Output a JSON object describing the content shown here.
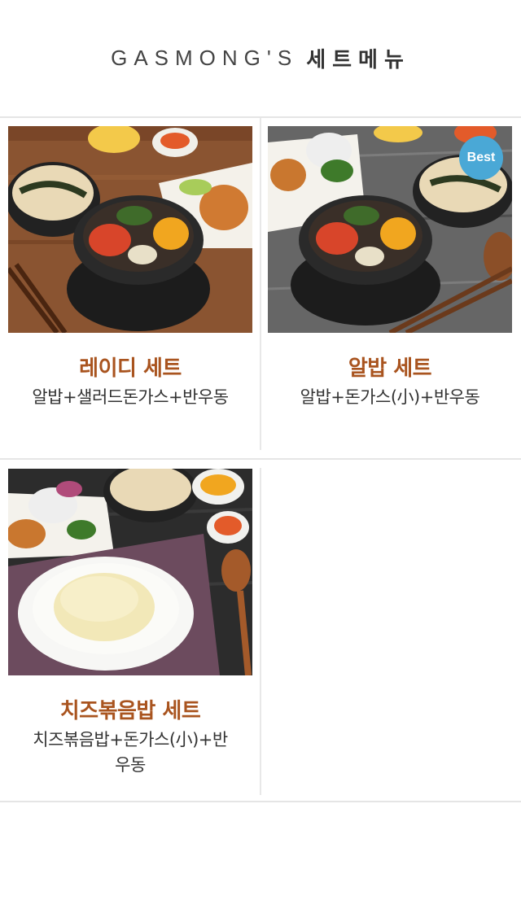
{
  "header": {
    "brand": "GASMONG'S",
    "title": "세트메뉴"
  },
  "items": [
    {
      "name": "레이디 세트",
      "description": "알밥+샐러드돈가스+반우동",
      "badge": "",
      "image": "lady-set-photo"
    },
    {
      "name": "알밥 세트",
      "description": "알밥+돈가스(小)+반우동",
      "badge": "Best",
      "image": "albap-set-photo"
    },
    {
      "name": "치즈볶음밥 세트",
      "description": "치즈볶음밥+돈가스(小)+반우동",
      "badge": "",
      "image": "cheese-fried-rice-set-photo"
    }
  ],
  "colors": {
    "accent": "#a9541f",
    "badge": "#4aa8d6"
  }
}
